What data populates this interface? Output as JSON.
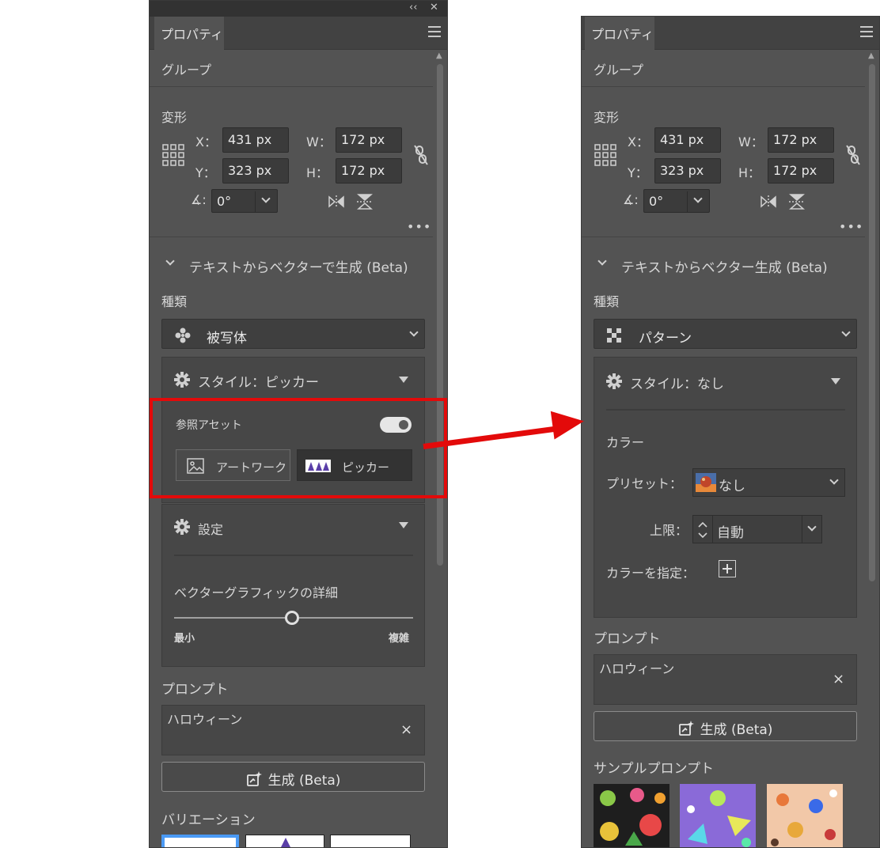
{
  "left_panel": {
    "collapse_glyph": "‹‹",
    "close_glyph": "✕",
    "tab_label": "プロパティ",
    "selection_type": "グループ",
    "transform": {
      "title": "変形",
      "x_label": "X：",
      "x_value": "431 px",
      "y_label": "Y：",
      "y_value": "323 px",
      "w_label": "W：",
      "w_value": "172 px",
      "h_label": "H：",
      "h_value": "172 px",
      "angle_label": "∡:",
      "angle_value": "0°"
    },
    "gen_section_title": "テキストからベクターで生成 (Beta)",
    "type_label": "種類",
    "type_value": "被写体",
    "style_label": "スタイル：ピッカー",
    "ref_asset_label": "参照アセット",
    "ref_asset_on": true,
    "artwork_button": "アートワーク",
    "picker_button": "ピッカー",
    "settings_label": "設定",
    "detail_label": "ベクターグラフィックの詳細",
    "slider_value": 0.5,
    "slider_min": "最小",
    "slider_max": "複雑",
    "prompt_label": "プロンプト",
    "prompt_value": "ハロウィーン",
    "clear_glyph": "×",
    "generate_label": "生成 (Beta)",
    "variations_label": "バリエーション"
  },
  "right_panel": {
    "tab_label": "プロパティ",
    "selection_type": "グループ",
    "transform": {
      "title": "変形",
      "x_label": "X：",
      "x_value": "431 px",
      "y_label": "Y：",
      "y_value": "323 px",
      "w_label": "W：",
      "w_value": "172 px",
      "h_label": "H：",
      "h_value": "172 px",
      "angle_label": "∡:",
      "angle_value": "0°"
    },
    "gen_section_title": "テキストからベクター生成 (Beta)",
    "type_label": "種類",
    "type_value": "パターン",
    "style_label": "スタイル：なし",
    "color_label": "カラー",
    "preset_label": "プリセット：",
    "preset_value": "なし",
    "limit_label": "上限：",
    "limit_value": "自動",
    "specify_color_label": "カラーを指定：",
    "prompt_label": "プロンプト",
    "prompt_value": "ハロウィーン",
    "clear_glyph": "×",
    "generate_label": "生成 (Beta)",
    "sample_prompts_label": "サンプルプロンプト"
  },
  "colors": {
    "panel_bg": "#535353",
    "highlight_red": "#e30a0a",
    "selection_blue": "#4a9af5"
  }
}
